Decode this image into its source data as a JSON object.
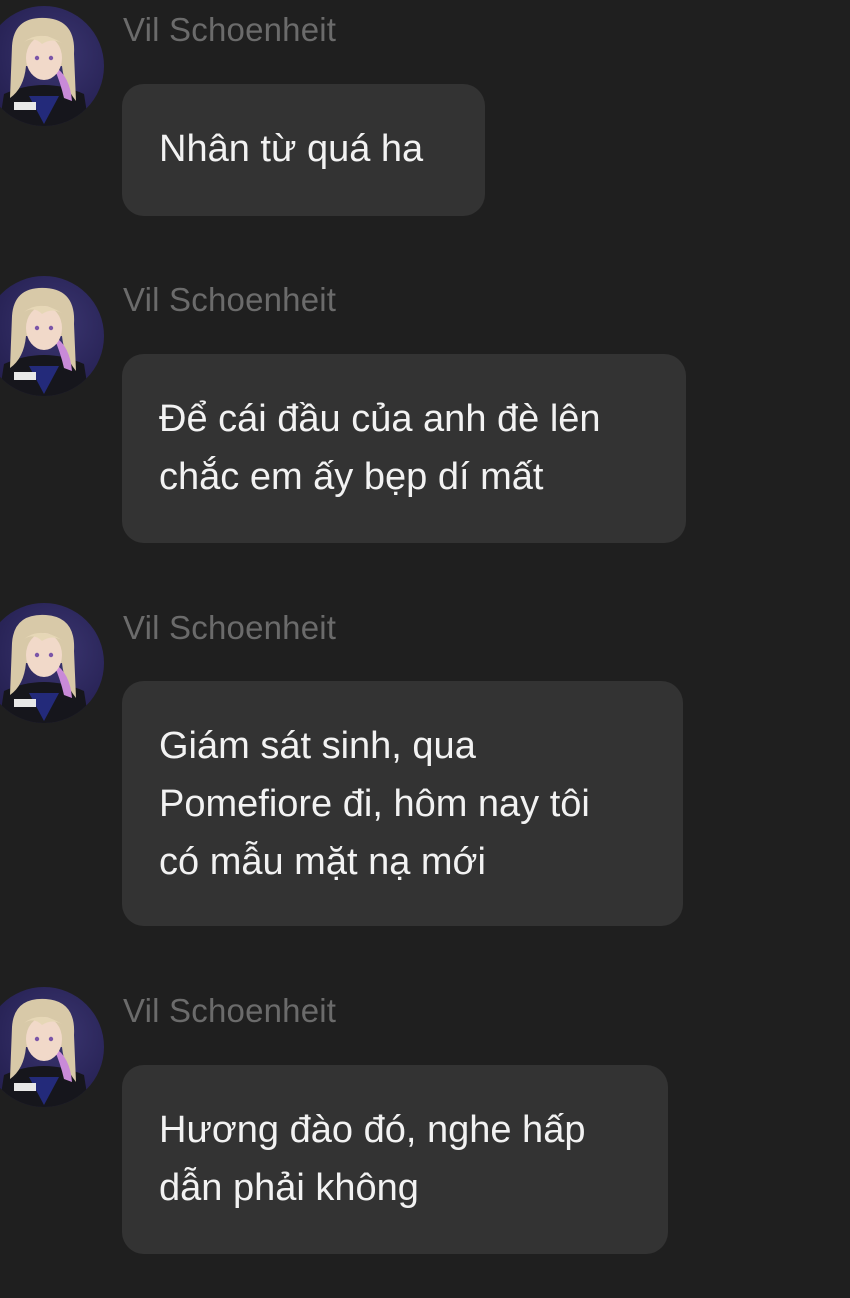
{
  "messages": [
    {
      "sender": "Vil Schoenheit",
      "lines": [
        "Nhân từ quá ha"
      ]
    },
    {
      "sender": "Vil Schoenheit",
      "lines": [
        "Để cái đầu của anh đè lên",
        "chắc em ấy bẹp dí mất"
      ]
    },
    {
      "sender": "Vil Schoenheit",
      "lines": [
        "Giám sát sinh, qua",
        "Pomefiore đi, hôm nay tôi",
        "có mẫu mặt nạ mới"
      ]
    },
    {
      "sender": "Vil Schoenheit",
      "lines": [
        "Hương đào đó, nghe hấp",
        "dẫn phải không"
      ]
    }
  ],
  "icons": {
    "avatar": "character-avatar-icon"
  },
  "colors": {
    "background": "#1f1f1f",
    "bubble": "#333333",
    "sender_text": "#6b6b6b",
    "message_text": "#f2f2f2"
  }
}
